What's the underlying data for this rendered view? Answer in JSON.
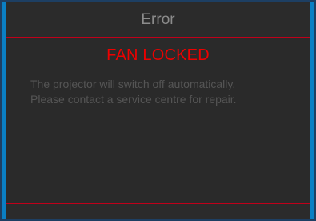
{
  "dialog": {
    "title": "Error",
    "heading": "FAN LOCKED",
    "message_lines": [
      "The projector will switch off automatically.",
      "Please contact a service centre for repair."
    ]
  },
  "colors": {
    "frame_accent": "#0a7fc4",
    "dialog_background": "#2a2a2a",
    "title_text": "#8c8c8c",
    "heading_text": "#ee0000",
    "divider": "#c0001a",
    "message_text": "#555555"
  }
}
